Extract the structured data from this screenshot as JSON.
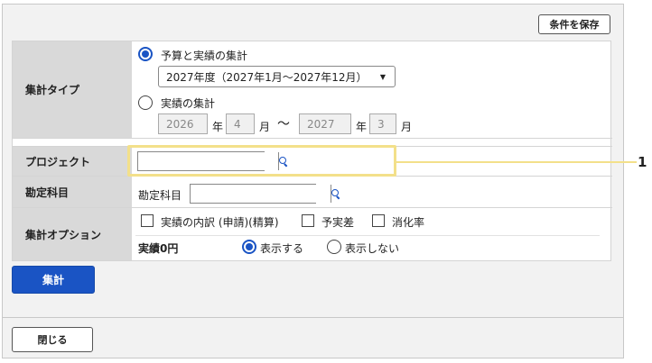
{
  "header": {
    "save_label": "条件を保存"
  },
  "rows": {
    "aggregation_type": {
      "label": "集計タイプ",
      "option_budget": "予算と実績の集計",
      "fiscal_select": "2027年度（2027年1月～2027年12月）",
      "option_actual": "実績の集計",
      "from_year": "2026",
      "year_unit": "年",
      "from_month": "4",
      "month_unit": "月",
      "tilde": "～",
      "to_year": "2027",
      "to_month": "3"
    },
    "project": {
      "label": "プロジェクト",
      "value": ""
    },
    "account": {
      "label": "勘定科目",
      "inline_label": "勘定科目",
      "value": ""
    },
    "options": {
      "label": "集計オプション",
      "check_breakdown": "実績の内訳 (申請)(精算)",
      "check_variance": "予実差",
      "check_consumption": "消化率",
      "zero_label": "実績0円",
      "show": "表示する",
      "hide": "表示しない"
    }
  },
  "actions": {
    "aggregate_label": "集計",
    "close_label": "閉じる"
  },
  "callout": {
    "number": "1"
  },
  "colors": {
    "accent": "#1a54c4",
    "highlight": "#f3e08a"
  },
  "icons": {
    "search": "search-icon",
    "dropdown": "chevron-down-icon"
  }
}
